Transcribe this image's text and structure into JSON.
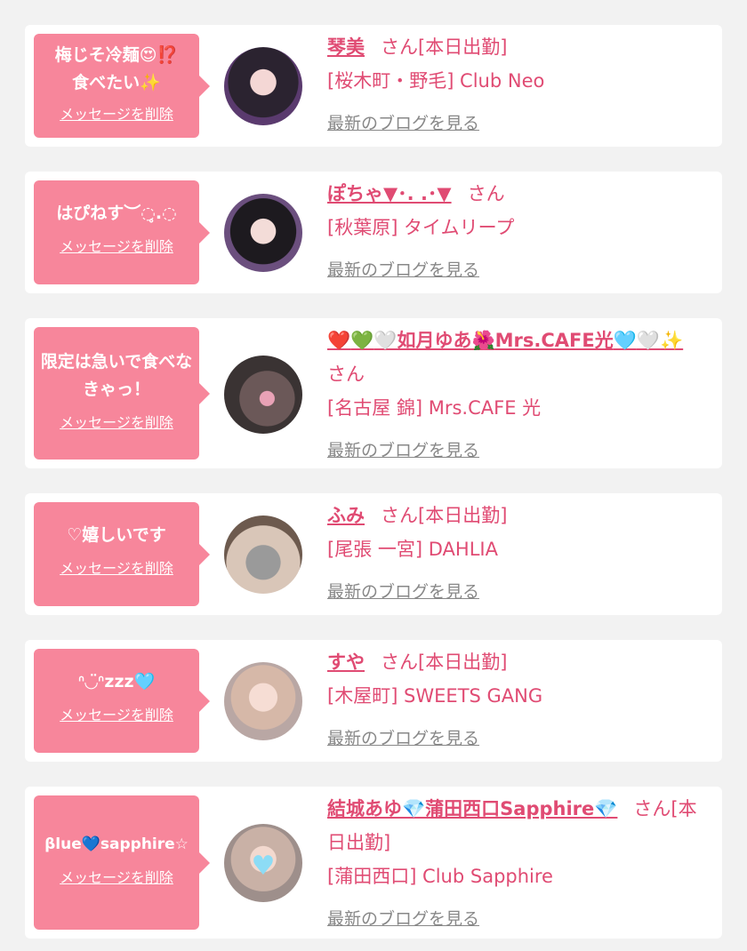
{
  "colors": {
    "accent": "#e04b73",
    "bubble": "#f7869b",
    "link_gray": "#888888",
    "background": "#f2f2f2"
  },
  "common": {
    "delete_label": "メッセージを削除",
    "blog_label": "最新のブログを見る"
  },
  "items": [
    {
      "message": "梅じそ冷麺😍⁉️食べたい✨",
      "name": "琴美",
      "suffix": "さん[本日出勤]",
      "shop": "[桜木町・野毛] Club Neo",
      "avatar_icon": "girl-photo-avatar"
    },
    {
      "message": "はぴねす︶◌̥.◌",
      "name": "ぽちゃ▼･. .･▼",
      "suffix": "さん",
      "shop": "[秋葉原] タイムリープ",
      "avatar_icon": "girl-photo-avatar"
    },
    {
      "message": "限定は急いで食べなきゃっ！",
      "name_parts": [
        "❤️",
        "💚",
        "🤍",
        "如月ゆあ",
        "🌺",
        "Mrs.CAFE光",
        "🩵",
        "🤍",
        "✨"
      ],
      "suffix": "さん",
      "shop": "[名古屋 錦] Mrs.CAFE 光",
      "avatar_icon": "girl-photo-avatar"
    },
    {
      "message": "♡嬉しいです",
      "name": "ふみ",
      "suffix": "さん[本日出勤]",
      "shop": "[尾張 一宮] DAHLIA",
      "avatar_icon": "girl-photo-avatar"
    },
    {
      "message": "ᐢ◡̈ᐢzzz🩵",
      "name": "すや",
      "suffix": "さん[本日出勤]",
      "shop": "[木屋町] SWEETS GANG",
      "avatar_icon": "girl-photo-avatar"
    },
    {
      "message": "βlue💙sapphire☆",
      "name": "結城あゆ💎蒲田西口Sapphire💎",
      "suffix": "さん[本日出勤]",
      "shop": "[蒲田西口] Club Sapphire",
      "avatar_icon": "girl-photo-avatar"
    }
  ]
}
